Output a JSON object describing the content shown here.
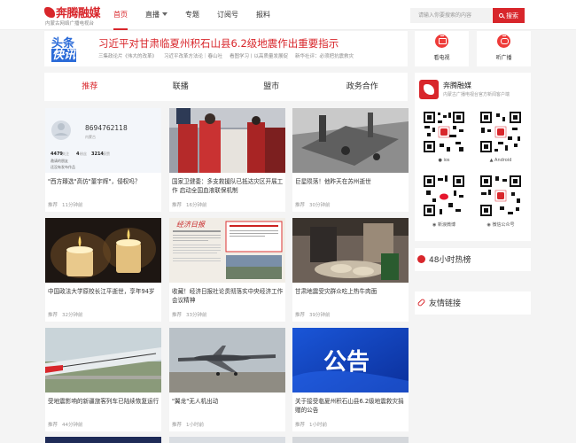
{
  "brand": {
    "name": "奔腾融媒",
    "subtitle": "内蒙古网络广播电视台"
  },
  "nav": {
    "items": [
      {
        "label": "首页",
        "active": true,
        "dropdown": false
      },
      {
        "label": "直播",
        "active": false,
        "dropdown": true
      },
      {
        "label": "专题",
        "active": false,
        "dropdown": false
      },
      {
        "label": "订阅号",
        "active": false,
        "dropdown": false
      },
      {
        "label": "报料",
        "active": false,
        "dropdown": false
      }
    ]
  },
  "search": {
    "placeholder": "请输入你要搜索的内容",
    "button_label": "搜索"
  },
  "headline": {
    "badge_top": "头条",
    "badge_bottom": "快讯",
    "title": "习近平对甘肃临夏州积石山县6.2级地震作出重要指示",
    "subs": [
      "三集政论片《伟大的改革》",
      "习近平改革方法论｜春山吐",
      "看图学习丨以高质量发展促",
      "新华社评：必须把抗震救灾"
    ]
  },
  "quick_links": [
    {
      "label": "看电视",
      "icon": "tv-icon"
    },
    {
      "label": "听广播",
      "icon": "radio-icon"
    }
  ],
  "tabs": [
    {
      "label": "推荐",
      "active": true
    },
    {
      "label": "联播",
      "active": false
    },
    {
      "label": "盟市",
      "active": false
    },
    {
      "label": "政务合作",
      "active": false
    }
  ],
  "profile_mock": {
    "phone": "8694762118",
    "sub": "内蒙古",
    "stats": [
      {
        "num": "4479",
        "label": "关注"
      },
      {
        "num": "4",
        "label": "粉丝"
      },
      {
        "num": "3214",
        "label": "获赞"
      }
    ],
    "note1": "邀请的朋友",
    "note2": "还没有发布作品"
  },
  "thumb_text": {
    "newspaper_name": "经济日报",
    "gongao": "公告"
  },
  "articles": [
    {
      "title": "\"西方臻选\"高仿\"董宇辉\"，侵权吗？",
      "source": "推荐",
      "time": "11分钟前",
      "image": "profile-screenshot"
    },
    {
      "title": "国家卫健委：多支救援队已抵达灾区开展工作 启动全国血液联保机制",
      "source": "推荐",
      "time": "16分钟前",
      "image": "rescue-workers-photo"
    },
    {
      "title": "巨星陨落！他昨天在苏州逝世",
      "source": "推荐",
      "time": "30分钟前",
      "image": "historic-bw-photo"
    },
    {
      "title": "中国政法大学原校长江平逝世，享年94岁",
      "source": "推荐",
      "time": "32分钟前",
      "image": "candles-photo"
    },
    {
      "title": "收藏！经济日报社论贯彻落实中央经济工作会议精神",
      "source": "推荐",
      "time": "33分钟前",
      "image": "newspaper-photo"
    },
    {
      "title": "甘肃地震受灾群众吃上热牛肉面",
      "source": "推荐",
      "time": "39分钟前",
      "image": "noodles-photo"
    },
    {
      "title": "受地震影响的新疆旅客列车已陆续恢复运行",
      "source": "推荐",
      "time": "44分钟前",
      "image": "train-photo"
    },
    {
      "title": "\"翼龙\"无人机出动",
      "source": "推荐",
      "time": "1小时前",
      "image": "drone-photo"
    },
    {
      "title": "关于接受临夏州积石山县6.2级地震救灾捐赠的公告",
      "source": "推荐",
      "time": "1小时前",
      "image": "announcement-graphic"
    }
  ],
  "sidebar": {
    "name": "奔腾融媒",
    "desc": "内蒙古广播电视台官方新闻客户端",
    "qr_codes": [
      {
        "label": "ios"
      },
      {
        "label": "Android"
      },
      {
        "label": "新浪微博"
      },
      {
        "label": "微信公众号"
      }
    ],
    "sections": [
      {
        "title": "48小时热榜"
      },
      {
        "title": "友情链接"
      }
    ]
  },
  "colors": {
    "accent": "#d8262b",
    "headline_blue": "#2b6bd8",
    "page_bg": "#f4f4f4"
  }
}
